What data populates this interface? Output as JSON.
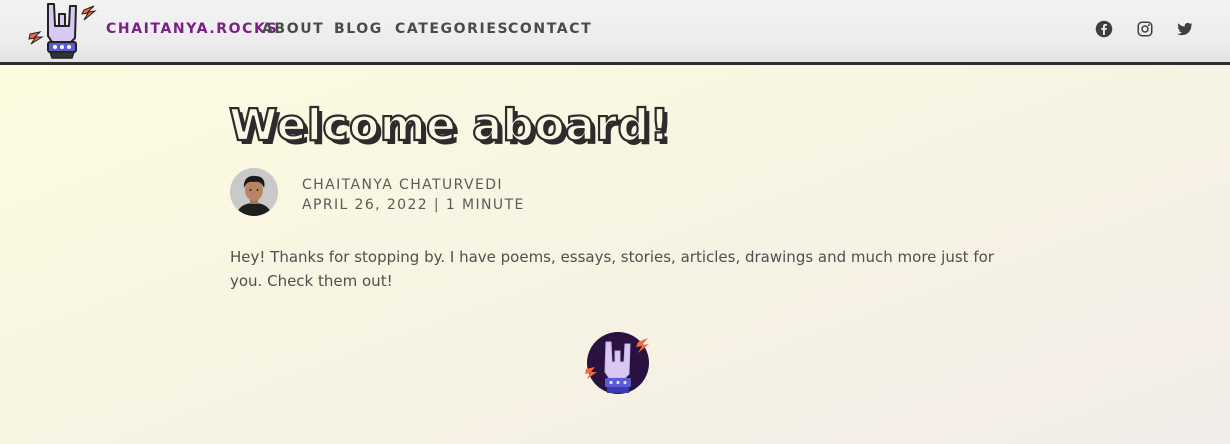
{
  "header": {
    "brand": "CHAITANYA.ROCKS",
    "nav": [
      {
        "label": "ABOUT"
      },
      {
        "label": "BLOG"
      },
      {
        "label": "CATEGORIES"
      },
      {
        "label": "CONTACT"
      }
    ],
    "social": [
      {
        "icon": "facebook-icon"
      },
      {
        "icon": "instagram-icon"
      },
      {
        "icon": "twitter-icon"
      }
    ]
  },
  "post": {
    "title": "Welcome aboard!",
    "author": "CHAITANYA CHATURVEDI",
    "meta": "APRIL 26, 2022 | 1 MINUTE",
    "body": "Hey! Thanks for stopping by. I have poems, essays, stories, articles, drawings and much more just for you. Check them out!"
  },
  "colors": {
    "brand": "#7a1f86",
    "nav_text": "#4a4a4a",
    "title_fill": "#fbf7e4",
    "title_outline": "#2c2c2c",
    "badge_bg": "#2a1240",
    "hand": "#d9c8f2",
    "wristband": "#5b5bd6",
    "bolt": "#f26a3d"
  }
}
